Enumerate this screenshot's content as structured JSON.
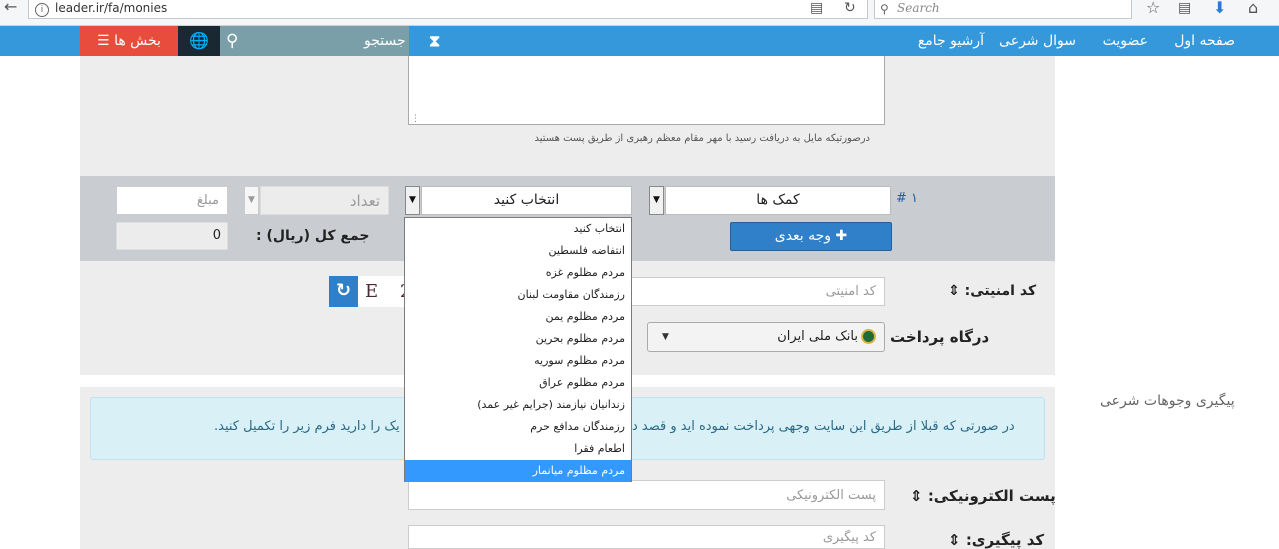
{
  "browser": {
    "url": "leader.ir/fa/monies",
    "search_placeholder": "Search"
  },
  "nav": {
    "links": [
      "صفحه اول",
      "عضویت",
      "سوال شرعی",
      "آرشیو جامع"
    ],
    "search_label": "جستجو",
    "sections_label": "بخش ها"
  },
  "receipt_note": "درصورتیکه مایل به دریافت رسید با مهر مقام معظم رهبری از طریق پست هستید",
  "donation": {
    "row_number": "۱ #",
    "category_value": "کمک ها",
    "subcategory_value": "انتخاب کنید",
    "count_placeholder": "تعداد",
    "amount_placeholder": "مبلغ",
    "next_button": "وجه بعدی",
    "total_label": "جمع کل (ریال) :",
    "total_value": "0",
    "options": [
      "انتخاب کنید",
      "انتفاضه فلسطین",
      "مردم مظلوم غزه",
      "رزمندگان مقاومت لبنان",
      "مردم مظلوم یمن",
      "مردم مظلوم بحرین",
      "مردم مظلوم سوریه",
      "مردم مظلوم عراق",
      "زندانیان نیازمند (جرایم غیر عمد)",
      "رزمندگان مدافع حرم",
      "اطعام فقرا",
      "مردم مظلوم میانمار"
    ],
    "selected_option": "مردم مظلوم میانمار"
  },
  "security": {
    "label": "کد امنیتی:",
    "placeholder": "کد امنیتی",
    "captcha_text": "E 2"
  },
  "gateway": {
    "label": "درگاه پرداخت",
    "value": "بانک ملی ایران"
  },
  "tracking": {
    "side_title": "پیگیری وجوهات شرعی",
    "info_text": "در صورتی که قبلا از طریق این سایت وجهی پرداخت نموده اید و قصد د",
    "info_text_tail": "یک را دارید فرم زیر را تکمیل کنید.",
    "email_label": "پست الکترونیکی:",
    "email_placeholder": "پست الکترونیکی",
    "code_label": "کد پیگیری:",
    "code_placeholder": "کد پیگیری"
  }
}
